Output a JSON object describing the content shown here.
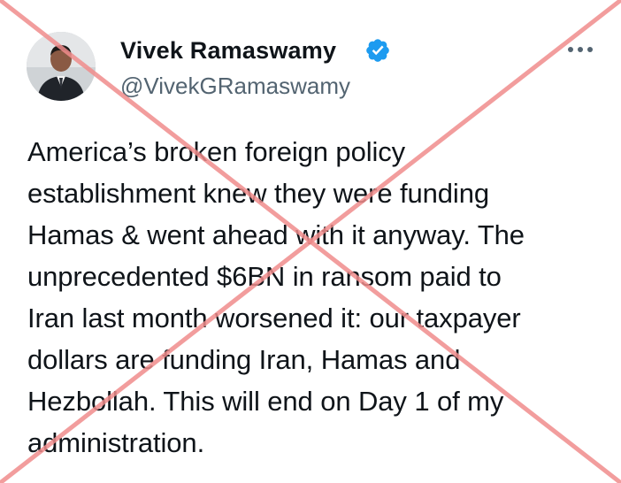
{
  "author": {
    "name": "Vivek Ramaswamy",
    "handle": "@VivekGRamaswamy",
    "verified": true
  },
  "tweet": {
    "text": "America’s broken foreign policy\nestablishment knew they were funding\nHamas & went ahead with it anyway. The\nunprecedented $6BN in ransom paid to\nIran last month worsened it: our taxpayer\ndollars are funding Iran, Hamas and\nHezbollah. This will end on Day 1 of my\nadministration."
  },
  "icons": {
    "verified": "verified-badge-icon",
    "more": "more-options-icon"
  },
  "overlay": {
    "type": "red-x-cross",
    "color": "#f08c8c"
  },
  "colors": {
    "text": "#0f1419",
    "secondary_text": "#536471",
    "verified_badge": "#1d9bf0"
  }
}
